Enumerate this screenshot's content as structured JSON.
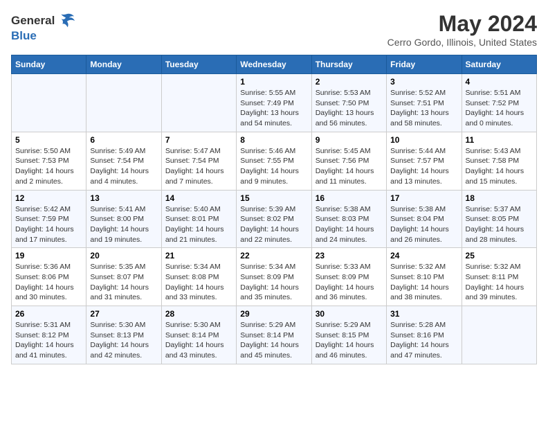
{
  "logo": {
    "line1": "General",
    "line2": "Blue"
  },
  "title": "May 2024",
  "subtitle": "Cerro Gordo, Illinois, United States",
  "days_of_week": [
    "Sunday",
    "Monday",
    "Tuesday",
    "Wednesday",
    "Thursday",
    "Friday",
    "Saturday"
  ],
  "weeks": [
    [
      {
        "day": "",
        "info": ""
      },
      {
        "day": "",
        "info": ""
      },
      {
        "day": "",
        "info": ""
      },
      {
        "day": "1",
        "info": "Sunrise: 5:55 AM\nSunset: 7:49 PM\nDaylight: 13 hours and 54 minutes."
      },
      {
        "day": "2",
        "info": "Sunrise: 5:53 AM\nSunset: 7:50 PM\nDaylight: 13 hours and 56 minutes."
      },
      {
        "day": "3",
        "info": "Sunrise: 5:52 AM\nSunset: 7:51 PM\nDaylight: 13 hours and 58 minutes."
      },
      {
        "day": "4",
        "info": "Sunrise: 5:51 AM\nSunset: 7:52 PM\nDaylight: 14 hours and 0 minutes."
      }
    ],
    [
      {
        "day": "5",
        "info": "Sunrise: 5:50 AM\nSunset: 7:53 PM\nDaylight: 14 hours and 2 minutes."
      },
      {
        "day": "6",
        "info": "Sunrise: 5:49 AM\nSunset: 7:54 PM\nDaylight: 14 hours and 4 minutes."
      },
      {
        "day": "7",
        "info": "Sunrise: 5:47 AM\nSunset: 7:54 PM\nDaylight: 14 hours and 7 minutes."
      },
      {
        "day": "8",
        "info": "Sunrise: 5:46 AM\nSunset: 7:55 PM\nDaylight: 14 hours and 9 minutes."
      },
      {
        "day": "9",
        "info": "Sunrise: 5:45 AM\nSunset: 7:56 PM\nDaylight: 14 hours and 11 minutes."
      },
      {
        "day": "10",
        "info": "Sunrise: 5:44 AM\nSunset: 7:57 PM\nDaylight: 14 hours and 13 minutes."
      },
      {
        "day": "11",
        "info": "Sunrise: 5:43 AM\nSunset: 7:58 PM\nDaylight: 14 hours and 15 minutes."
      }
    ],
    [
      {
        "day": "12",
        "info": "Sunrise: 5:42 AM\nSunset: 7:59 PM\nDaylight: 14 hours and 17 minutes."
      },
      {
        "day": "13",
        "info": "Sunrise: 5:41 AM\nSunset: 8:00 PM\nDaylight: 14 hours and 19 minutes."
      },
      {
        "day": "14",
        "info": "Sunrise: 5:40 AM\nSunset: 8:01 PM\nDaylight: 14 hours and 21 minutes."
      },
      {
        "day": "15",
        "info": "Sunrise: 5:39 AM\nSunset: 8:02 PM\nDaylight: 14 hours and 22 minutes."
      },
      {
        "day": "16",
        "info": "Sunrise: 5:38 AM\nSunset: 8:03 PM\nDaylight: 14 hours and 24 minutes."
      },
      {
        "day": "17",
        "info": "Sunrise: 5:38 AM\nSunset: 8:04 PM\nDaylight: 14 hours and 26 minutes."
      },
      {
        "day": "18",
        "info": "Sunrise: 5:37 AM\nSunset: 8:05 PM\nDaylight: 14 hours and 28 minutes."
      }
    ],
    [
      {
        "day": "19",
        "info": "Sunrise: 5:36 AM\nSunset: 8:06 PM\nDaylight: 14 hours and 30 minutes."
      },
      {
        "day": "20",
        "info": "Sunrise: 5:35 AM\nSunset: 8:07 PM\nDaylight: 14 hours and 31 minutes."
      },
      {
        "day": "21",
        "info": "Sunrise: 5:34 AM\nSunset: 8:08 PM\nDaylight: 14 hours and 33 minutes."
      },
      {
        "day": "22",
        "info": "Sunrise: 5:34 AM\nSunset: 8:09 PM\nDaylight: 14 hours and 35 minutes."
      },
      {
        "day": "23",
        "info": "Sunrise: 5:33 AM\nSunset: 8:09 PM\nDaylight: 14 hours and 36 minutes."
      },
      {
        "day": "24",
        "info": "Sunrise: 5:32 AM\nSunset: 8:10 PM\nDaylight: 14 hours and 38 minutes."
      },
      {
        "day": "25",
        "info": "Sunrise: 5:32 AM\nSunset: 8:11 PM\nDaylight: 14 hours and 39 minutes."
      }
    ],
    [
      {
        "day": "26",
        "info": "Sunrise: 5:31 AM\nSunset: 8:12 PM\nDaylight: 14 hours and 41 minutes."
      },
      {
        "day": "27",
        "info": "Sunrise: 5:30 AM\nSunset: 8:13 PM\nDaylight: 14 hours and 42 minutes."
      },
      {
        "day": "28",
        "info": "Sunrise: 5:30 AM\nSunset: 8:14 PM\nDaylight: 14 hours and 43 minutes."
      },
      {
        "day": "29",
        "info": "Sunrise: 5:29 AM\nSunset: 8:14 PM\nDaylight: 14 hours and 45 minutes."
      },
      {
        "day": "30",
        "info": "Sunrise: 5:29 AM\nSunset: 8:15 PM\nDaylight: 14 hours and 46 minutes."
      },
      {
        "day": "31",
        "info": "Sunrise: 5:28 AM\nSunset: 8:16 PM\nDaylight: 14 hours and 47 minutes."
      },
      {
        "day": "",
        "info": ""
      }
    ]
  ]
}
